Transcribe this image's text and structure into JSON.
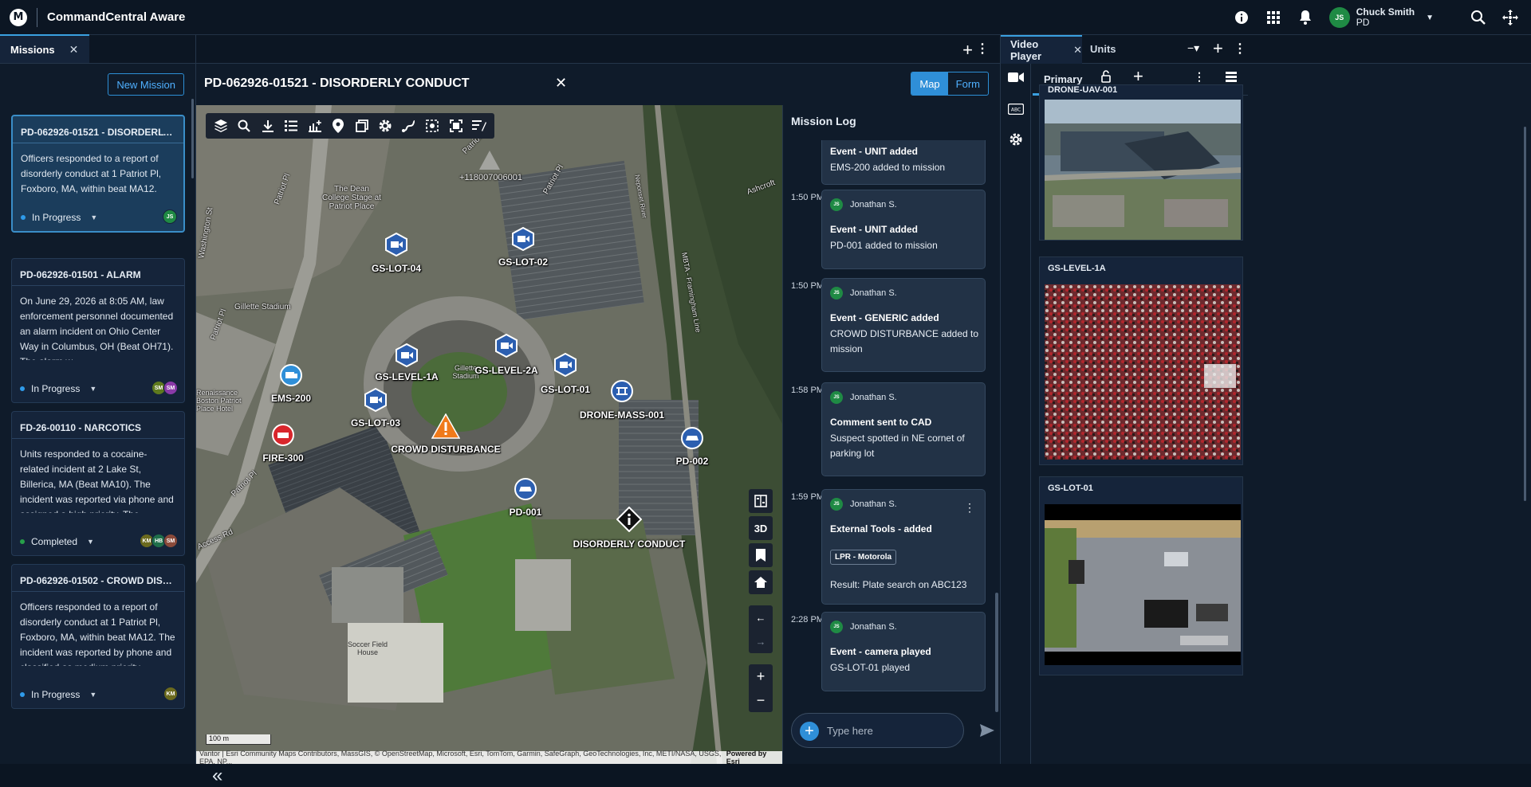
{
  "app": {
    "title": "CommandCentral Aware"
  },
  "user": {
    "initials": "JS",
    "name": "Chuck Smith",
    "org": "PD"
  },
  "left_tab": {
    "label": "Missions"
  },
  "new_mission_label": "New Mission",
  "missions": [
    {
      "title": "PD-062926-01521 - DISORDERLY COND...",
      "desc": "Officers responded to a report of disorderly conduct at 1 Patriot Pl, Foxboro, MA, within beat MA12. The incident was reported by phone and classified as medium priority....",
      "status": "In Progress",
      "status_color": "#2f9bea",
      "avatars": [
        {
          "i": "JS",
          "c": "#1f8a44"
        }
      ]
    },
    {
      "title": "PD-062926-01501 - ALARM",
      "desc": "On June 29, 2026 at 8:05 AM, law enforcement personnel documented an alarm incident on Ohio Center Way in Columbus, OH (Beat OH71). The alarm w...",
      "status": "In Progress",
      "status_color": "#2f9bea",
      "avatars": [
        {
          "i": "SM",
          "c": "#5f7a1e"
        },
        {
          "i": "SM",
          "c": "#8a3aa8"
        }
      ]
    },
    {
      "title": "FD-26-00110 - NARCOTICS",
      "desc": "Units responded to a cocaine-related incident at 2 Lake St, Billerica, MA (Beat MA10). The incident was reported via phone and assigned a high priority. The...",
      "status": "Completed",
      "status_color": "#27a04a",
      "avatars": [
        {
          "i": "KM",
          "c": "#6b6a1e"
        },
        {
          "i": "HB",
          "c": "#1f6f4a"
        },
        {
          "i": "SM",
          "c": "#8a4a3a"
        }
      ]
    },
    {
      "title": "PD-062926-01502 - CROWD DISTURBA...",
      "desc": "Officers responded to a report of disorderly conduct at 1 Patriot Pl, Foxboro, MA, within beat MA12. The incident was reported by phone and classified as medium priority....",
      "status": "In Progress",
      "status_color": "#2f9bea",
      "avatars": [
        {
          "i": "KM",
          "c": "#6b6a1e"
        }
      ]
    }
  ],
  "mission_header": {
    "title": "PD-062926-01521 - DISORDERLY CONDUCT",
    "view_map": "Map",
    "view_form": "Form"
  },
  "map": {
    "coord_label": "+118007006001",
    "markers": [
      {
        "label": "GS-LOT-04"
      },
      {
        "label": "GS-LOT-02"
      },
      {
        "label": "GS-LEVEL-1A"
      },
      {
        "label": "GS-LEVEL-2A"
      },
      {
        "label": "GS-LOT-01"
      },
      {
        "label": "GS-LOT-03"
      },
      {
        "label": "EMS-200"
      },
      {
        "label": "FIRE-300"
      },
      {
        "label": "CROWD DISTURBANCE"
      },
      {
        "label": "DRONE-MASS-001"
      },
      {
        "label": "PD-002"
      },
      {
        "label": "PD-001"
      },
      {
        "label": "DISORDERLY CONDUCT"
      }
    ],
    "place_labels": [
      "The Dean College Stage at Patriot Place",
      "Gillette Stadium",
      "Gillette Stadium",
      "Renaissance Boston Patriot Place Hotel",
      "Patriot Pl",
      "Patriot Pl",
      "Patriot Pl",
      "Patriot Pl",
      "Patriot Pl",
      "Access Rd",
      "Ashcroft",
      "MBTA - Framingham Line",
      "Neponset River",
      "Soccer Field House",
      "Washington St"
    ],
    "ctl_3d": "3D",
    "scale": "100 m",
    "attribution": "Vantor | Esri Community Maps Contributors, MassGIS, © OpenStreetMap, Microsoft, Esri, TomTom, Garmin, SafeGraph, GeoTechnologies, Inc, METI/NASA, USGS, EPA, NP...",
    "powered": "Powered by Esri"
  },
  "log": {
    "title": "Mission Log",
    "entries": [
      {
        "time": "",
        "author": "",
        "head": "Event - UNIT added",
        "body": "EMS-200 added to mission"
      },
      {
        "time": "1:50 PM",
        "author": "Jonathan S.",
        "head": "Event - UNIT added",
        "body": "PD-001 added to mission"
      },
      {
        "time": "1:50 PM",
        "author": "Jonathan S.",
        "head": "Event - GENERIC added",
        "body": "CROWD DISTURBANCE added to mission"
      },
      {
        "time": "1:58 PM",
        "author": "Jonathan S.",
        "head": "Comment sent to CAD",
        "body": "Suspect spotted in NE cornet of parking lot"
      },
      {
        "time": "1:59 PM",
        "author": "Jonathan S.",
        "head": "External Tools - added",
        "chip": "LPR - Motorola",
        "body": "Result:  Plate search on ABC123"
      },
      {
        "time": "2:28 PM",
        "author": "Jonathan S.",
        "head": "Event - camera played",
        "body": "GS-LOT-01 played"
      }
    ],
    "author_initials": "JS",
    "placeholder": "Type here"
  },
  "right": {
    "tab_video": "Video Player",
    "tab_units": "Units",
    "primary": "Primary",
    "cameras": [
      {
        "name": "DRONE-UAV-001"
      },
      {
        "name": "GS-LEVEL-1A"
      },
      {
        "name": "GS-LOT-01"
      }
    ]
  },
  "colors": {
    "accent": "#2f8fd8",
    "background": "#0f1b2a",
    "alert": "#f07a1a",
    "fire": "#d9262c",
    "unit": "#2c5fb0"
  }
}
